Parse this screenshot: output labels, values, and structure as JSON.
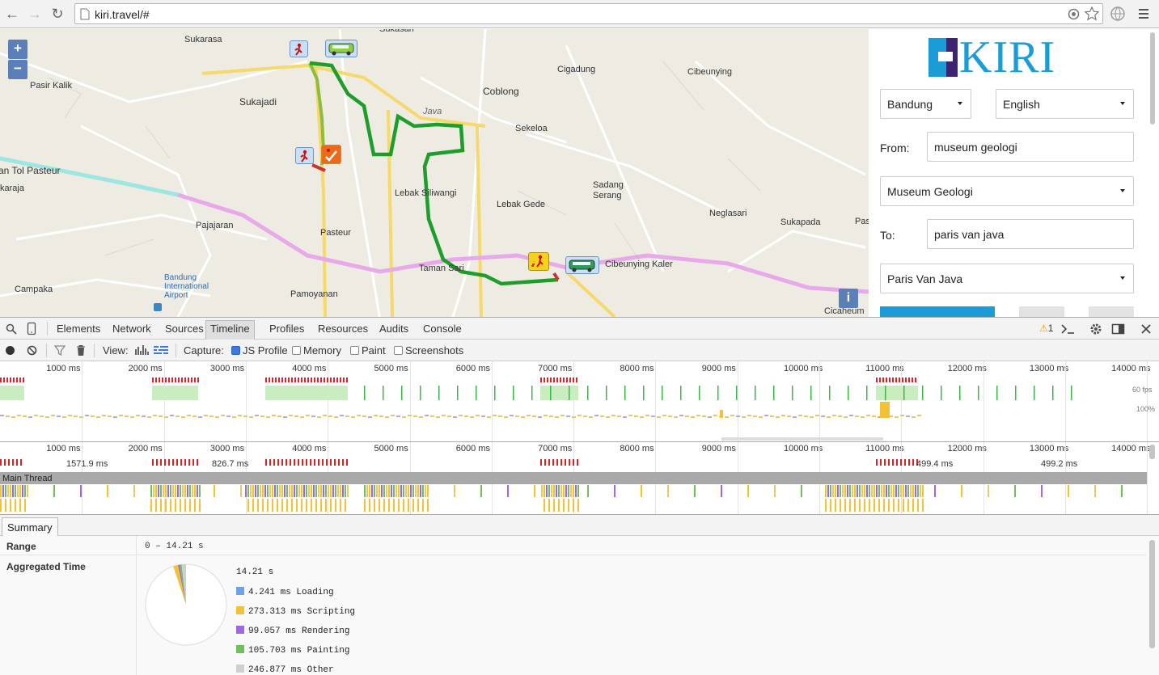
{
  "browser": {
    "url": "kiri.travel/#",
    "back_icon": "←",
    "forward_icon": "→",
    "reload_icon": "↻"
  },
  "map": {
    "zoom_in": "+",
    "zoom_out": "−",
    "info": "i",
    "labels": [
      {
        "text": "Sukarasa",
        "cls": ""
      },
      {
        "text": "Pasir Kalik",
        "cls": ""
      },
      {
        "text": "Sukajadi",
        "cls": "big"
      },
      {
        "text": "Sukasari",
        "cls": ""
      },
      {
        "text": "Cigadung",
        "cls": ""
      },
      {
        "text": "Coblong",
        "cls": "big"
      },
      {
        "text": "Cibeunying",
        "cls": ""
      },
      {
        "text": "Sekeloa",
        "cls": ""
      },
      {
        "text": "Lebak Siliwangi",
        "cls": ""
      },
      {
        "text": "Lebak Gede",
        "cls": ""
      },
      {
        "text": "Sadang",
        "cls": ""
      },
      {
        "text": "Serang",
        "cls": ""
      },
      {
        "text": "Neglasari",
        "cls": ""
      },
      {
        "text": "Sukapada",
        "cls": ""
      },
      {
        "text": "Pajajaran",
        "cls": ""
      },
      {
        "text": "Pasteur",
        "cls": ""
      },
      {
        "text": "Taman Sari",
        "cls": ""
      },
      {
        "text": "Cibeunying Kaler",
        "cls": ""
      },
      {
        "text": "Campaka",
        "cls": ""
      },
      {
        "text": "Pamoyanan",
        "cls": ""
      },
      {
        "text": "Cicaheum",
        "cls": ""
      },
      {
        "text": "an Tol Pasteur",
        "cls": "big"
      },
      {
        "text": "karaja",
        "cls": ""
      },
      {
        "text": "Java",
        "cls": ""
      },
      {
        "text": "Pas",
        "cls": ""
      }
    ],
    "airport": [
      "Bandung",
      "International",
      "Airport"
    ]
  },
  "panel": {
    "logo_text": "KIRI",
    "city": "Bandung",
    "language": "English",
    "from_label": "From:",
    "from_value": "museum geologi",
    "from_select": "Museum Geologi",
    "to_label": "To:",
    "to_value": "paris van java",
    "to_select": "Paris Van Java"
  },
  "devtools": {
    "tabs": [
      "Elements",
      "Network",
      "Sources",
      "Timeline",
      "Profiles",
      "Resources",
      "Audits",
      "Console"
    ],
    "active_tab": "Timeline",
    "warning_count": "1",
    "view_label": "View:",
    "capture_label": "Capture:",
    "capture_options": [
      {
        "label": "JS Profile",
        "checked": true
      },
      {
        "label": "Memory",
        "checked": false
      },
      {
        "label": "Paint",
        "checked": false
      },
      {
        "label": "Screenshots",
        "checked": false
      }
    ],
    "ticks": [
      "1000 ms",
      "2000 ms",
      "3000 ms",
      "4000 ms",
      "5000 ms",
      "6000 ms",
      "7000 ms",
      "8000 ms",
      "9000 ms",
      "10000 ms",
      "11000 ms",
      "12000 ms",
      "13000 ms",
      "14000 ms"
    ],
    "fps_label": "60 fps",
    "cpu_label": "100%",
    "frame_durations": [
      "1571.9 ms",
      "826.7 ms",
      "499.4 ms",
      "499.2 ms"
    ],
    "main_thread": "Main Thread",
    "summary_tab": "Summary",
    "range_label": "Range",
    "range_value": "0 – 14.21 s",
    "aggregated_label": "Aggregated Time",
    "total": "14.21 s",
    "legend": [
      {
        "label": "4.241 ms Loading",
        "color": "#6fa1e8",
        "value": 4.241
      },
      {
        "label": "273.313 ms Scripting",
        "color": "#f2c136",
        "value": 273.313
      },
      {
        "label": "99.057 ms Rendering",
        "color": "#9f68e0",
        "value": 99.057
      },
      {
        "label": "105.703 ms Painting",
        "color": "#6fbf5b",
        "value": 105.703
      },
      {
        "label": "246.877 ms Other",
        "color": "#cfcfcf",
        "value": 246.877
      }
    ],
    "idle_ms": 13480.8
  }
}
